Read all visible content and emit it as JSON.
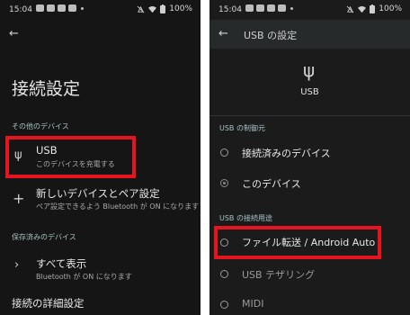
{
  "status": {
    "time": "15:04",
    "battery": "100%"
  },
  "left": {
    "title": "接続設定",
    "other_devices_header": "その他のデバイス",
    "usb_item": {
      "title": "USB",
      "subtitle": "このデバイスを充電する"
    },
    "pair_item": {
      "title": "新しいデバイスとペア設定",
      "subtitle": "ペア設定できるよう Bluetooth が ON になります"
    },
    "saved_devices_header": "保存済みのデバイス",
    "show_all_item": {
      "title": "すべて表示",
      "subtitle": "Bluetooth が ON になります"
    },
    "advanced": "接続の詳細設定"
  },
  "right": {
    "toolbar_title": "USB の設定",
    "usb_label": "USB",
    "controlled_by_header": "USB の制御元",
    "controlled_by_options": [
      "接続済みのデバイス",
      "このデバイス"
    ],
    "controlled_by_selected": "このデバイス",
    "use_for_header": "USB の接続用途",
    "use_for_options": [
      "ファイル転送 / Android Auto",
      "USB テザリング",
      "MIDI"
    ]
  },
  "colors": {
    "highlight": "#e5141f",
    "section_header": "#a4c3c5",
    "background": "#151515"
  },
  "icons": [
    "back-arrow-icon",
    "usb-icon",
    "plus-icon",
    "chevron-right-icon",
    "wifi-icon",
    "battery-icon",
    "mute-icon"
  ]
}
